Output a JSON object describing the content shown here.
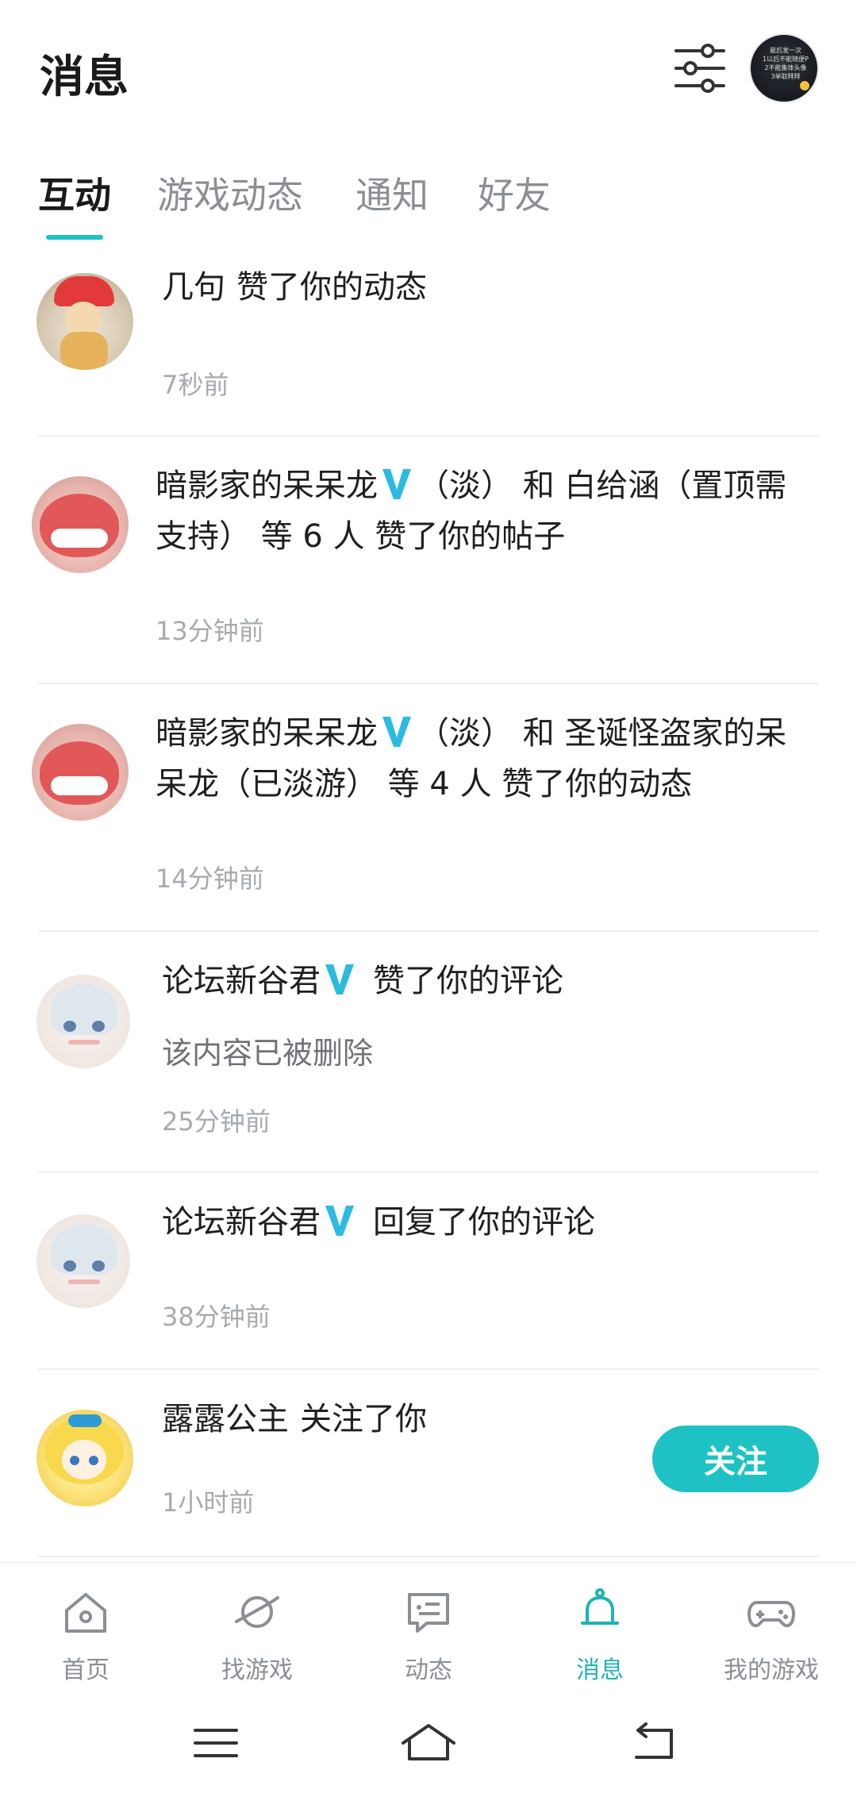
{
  "header": {
    "title": "消息",
    "profile_text": "最后发一次\n1以后不能随便P\n2不能集体头像\n3举取拜拜"
  },
  "tabs": [
    {
      "label": "互动",
      "active": true
    },
    {
      "label": "游戏动态"
    },
    {
      "label": "通知"
    },
    {
      "label": "好友"
    }
  ],
  "feed": {
    "items": [
      {
        "name": "几句",
        "action": "赞了你的动态",
        "time": "7秒前"
      },
      {
        "line1_name": "暗影家的呆呆龙",
        "line1_rest": "（淡） 和 白给涵（置顶需",
        "line2": "支持） 等 6 人 赞了你的帖子",
        "time": "13分钟前"
      },
      {
        "line1_name": "暗影家的呆呆龙",
        "line1_rest": "（淡） 和 圣诞怪盗家的呆",
        "line2": "呆龙（已淡游） 等 4 人 赞了你的动态",
        "time": "14分钟前"
      },
      {
        "name": "论坛新谷君",
        "action": "赞了你的评论",
        "subtext": "该内容已被删除",
        "time": "25分钟前"
      },
      {
        "name": "论坛新谷君",
        "action": "回复了你的评论",
        "time": "38分钟前"
      },
      {
        "name": "露露公主",
        "action": "关注了你",
        "time": "1小时前",
        "button": "关注"
      }
    ]
  },
  "nav": [
    {
      "label": "首页",
      "icon": "home-icon"
    },
    {
      "label": "找游戏",
      "icon": "planet-icon"
    },
    {
      "label": "动态",
      "icon": "chat-icon"
    },
    {
      "label": "消息",
      "icon": "bell-icon",
      "active": true
    },
    {
      "label": "我的游戏",
      "icon": "gamepad-icon"
    }
  ],
  "colors": {
    "accent": "#1fc2c4",
    "verified": "#2bbbe0"
  }
}
